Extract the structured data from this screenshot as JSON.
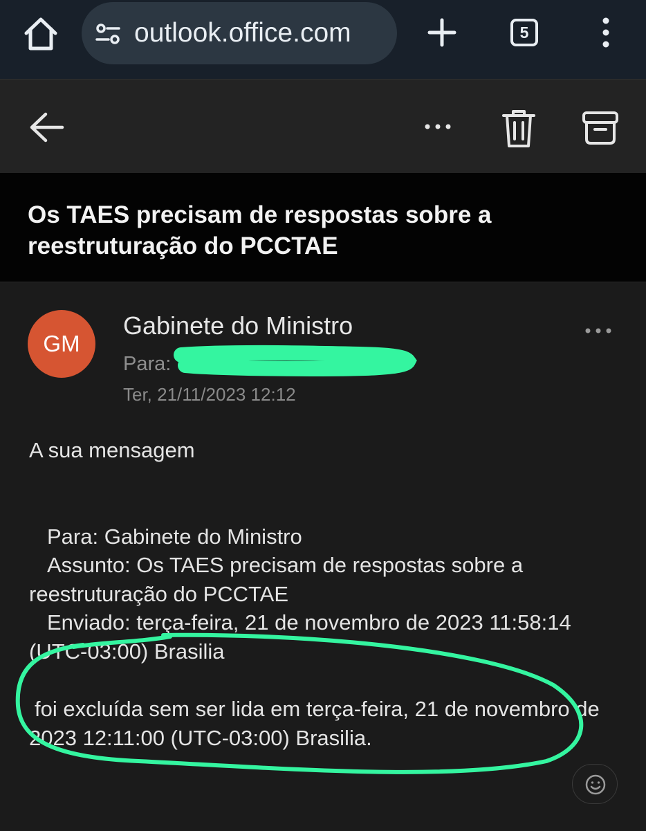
{
  "browser": {
    "url": "outlook.office.com",
    "tab_count": "5",
    "icons": [
      "home-icon",
      "site-settings-icon",
      "plus-icon",
      "tab-switcher-icon",
      "more-vertical-icon"
    ]
  },
  "toolbar": {
    "icons": [
      "back-arrow-icon",
      "more-horizontal-icon",
      "trash-icon",
      "archive-icon"
    ]
  },
  "email": {
    "subject": "Os TAES precisam de respostas sobre a reestruturação do PCCTAE",
    "avatar_initials": "GM",
    "avatar_color": "#d65532",
    "sender": "Gabinete do Ministro",
    "to_label": "Para:",
    "date": "Ter, 21/11/2023 12:12",
    "body": {
      "intro": "A sua mensagem",
      "to": "Para: Gabinete do Ministro",
      "subject_line": "Assunto: Os TAES precisam de respostas sobre a reestruturação do PCCTAE",
      "sent": "Enviado: terça-feira, 21 de novembro de 2023 11:58:14 (UTC-03:00) Brasilia",
      "deleted": "foi excluída sem ser lida em terça-feira, 21 de novembro de 2023 12:11:00 (UTC-03:00) Brasilia."
    }
  },
  "annotation_color": "#34f5a0"
}
